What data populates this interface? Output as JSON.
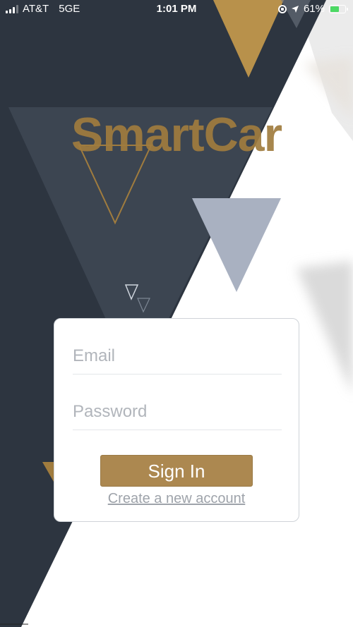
{
  "status_bar": {
    "carrier": "AT&T",
    "network": "5GE",
    "time": "1:01 PM",
    "battery_percent": "61%",
    "icons": [
      "signal-bars-icon",
      "orientation-lock-icon",
      "location-arrow-icon",
      "battery-charging-icon"
    ]
  },
  "app": {
    "title": "SmartCar"
  },
  "login_form": {
    "email_placeholder": "Email",
    "password_placeholder": "Password",
    "sign_in_label": "Sign In",
    "create_account_label": "Create a new account"
  },
  "colors": {
    "dark_background": "#2d3540",
    "accent_gold": "#ac8850",
    "triangle_slate": "#a9b1c1",
    "card_background": "#ffffff"
  }
}
